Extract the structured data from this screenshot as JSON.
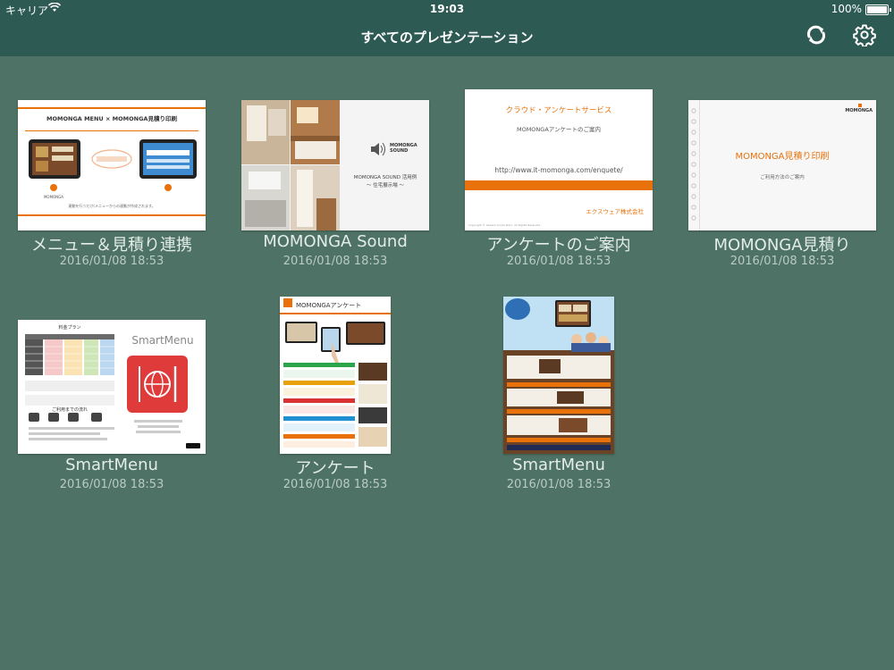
{
  "status_bar": {
    "carrier": "キャリア",
    "time": "19:03",
    "battery": "100%",
    "battery_level": 1.0
  },
  "nav": {
    "title": "すべてのプレゼンテーション",
    "refresh_icon": "refresh-icon",
    "settings_icon": "gear-icon"
  },
  "presentations": [
    {
      "name": "メニュー＆見積り連携",
      "date": "2016/01/08 18:53",
      "slide": {
        "heading": "MOMONGA MENU × MOMONGA見積り印刷",
        "footer": "連動を行うだけ(メニューからの連動が作成されます。",
        "logo": "MOMONGA"
      }
    },
    {
      "name": "MOMONGA Sound",
      "date": "2016/01/08 18:53",
      "slide": {
        "logo": "MOMONGA SOUND",
        "line1": "MOMONGA SOUND 活用例",
        "line2": "〜 住宅展示場 〜"
      }
    },
    {
      "name": "アンケートのご案内",
      "date": "2016/01/08 18:53",
      "slide": {
        "title": "クラウド・アンケートサービス",
        "subtitle": "MOMONGAアンケートのご案内",
        "url": "http://www.it-momonga.com/enquete/",
        "company": "エクスウェア株式会社",
        "copyright": "Copyright © Xsware Corporation. All Rights Reserved."
      }
    },
    {
      "name": "MOMONGA見積り",
      "date": "2016/01/08 18:53",
      "slide": {
        "logo": "MOMONGA",
        "title": "MOMONGA見積り印刷",
        "subtitle": "ご利用方法のご案内"
      }
    },
    {
      "name": "SmartMenu",
      "date": "2016/01/08 18:53",
      "slide": {
        "plan_title": "料金プラン",
        "brand": "SmartMenu",
        "flow_title": "ご利用までの流れ"
      }
    },
    {
      "name": "アンケート",
      "date": "2016/01/08 18:53",
      "slide": {
        "title": "MOMONGAアンケート"
      }
    },
    {
      "name": "SmartMenu",
      "date": "2016/01/08 18:53",
      "slide": {}
    }
  ],
  "colors": {
    "background": "#4e7265",
    "bar": "#2e5a54",
    "accent_orange": "#e8710a",
    "smartmenu_red": "#e03b3b"
  }
}
